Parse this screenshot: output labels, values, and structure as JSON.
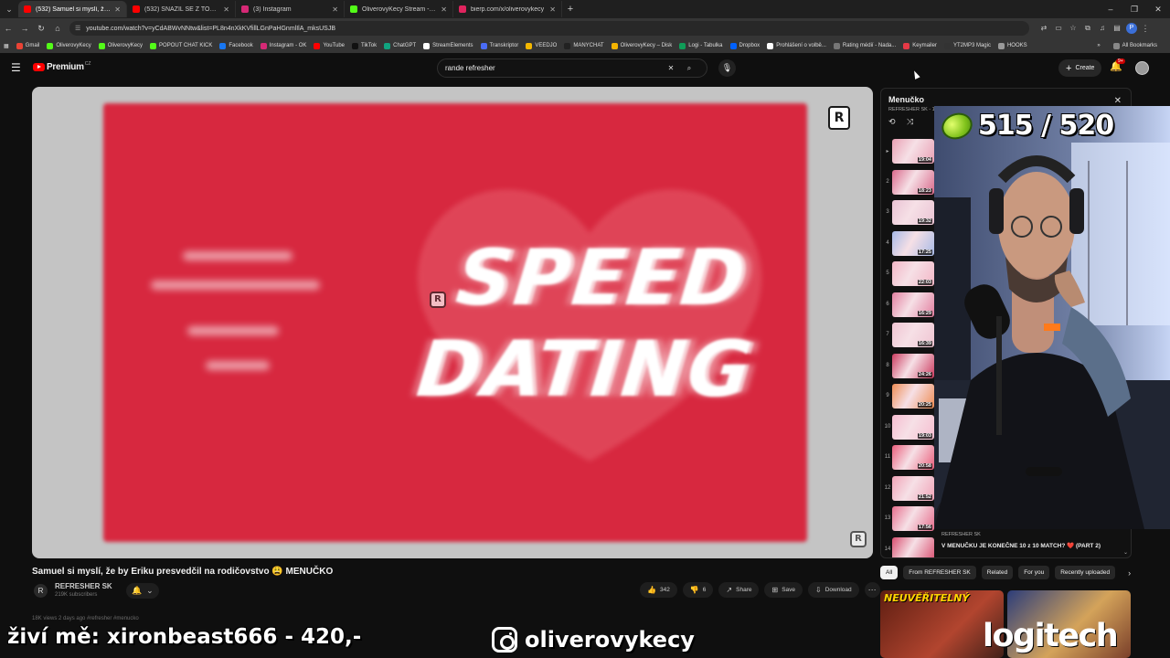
{
  "browser": {
    "tabs": [
      {
        "label": "(532) Samuel si myslí, že by",
        "favicon": "#ff0000",
        "active": true
      },
      {
        "label": "(532) SNAŽIL SE Z TOHO VYBR",
        "favicon": "#ff0000",
        "active": false
      },
      {
        "label": "(3) Instagram",
        "favicon": "#d62976",
        "active": false
      },
      {
        "label": "OliverovyKecy Stream - Watch",
        "favicon": "#53fc18",
        "active": false
      },
      {
        "label": "bierp.com/x/oliverovykecy",
        "favicon": "#e0245e",
        "active": false
      }
    ],
    "url": "youtube.com/watch?v=yCdABWvNNtw&list=PL8n4nXkKVfillLGnPaHGnmlIlA_mksUSJB",
    "bookmarks": [
      {
        "label": "Gmail",
        "color": "#ea4335"
      },
      {
        "label": "OliverovyKecy",
        "color": "#53fc18"
      },
      {
        "label": "OliverovyKecy",
        "color": "#53fc18"
      },
      {
        "label": "POPOUT CHAT KICK",
        "color": "#53fc18"
      },
      {
        "label": "Facebook",
        "color": "#1877f2"
      },
      {
        "label": "Instagram - OK",
        "color": "#d62976"
      },
      {
        "label": "YouTube",
        "color": "#ff0000"
      },
      {
        "label": "TikTok",
        "color": "#111111"
      },
      {
        "label": "ChatGPT",
        "color": "#10a37f"
      },
      {
        "label": "StreamElements",
        "color": "#ffffff"
      },
      {
        "label": "Transkriptor",
        "color": "#4a6cf7"
      },
      {
        "label": "VEEDJO",
        "color": "#f5b800"
      },
      {
        "label": "MANYCHAT",
        "color": "#222222"
      },
      {
        "label": "OliverovyKecy – Disk",
        "color": "#f4b400"
      },
      {
        "label": "Logi - Tabulka",
        "color": "#0f9d58"
      },
      {
        "label": "Dropbox",
        "color": "#0061ff"
      },
      {
        "label": "Prohlášení o volbě...",
        "color": "#ffffff"
      },
      {
        "label": "Rating médií - Nada...",
        "color": "#777777"
      },
      {
        "label": "Keymailer",
        "color": "#e63946"
      },
      {
        "label": "YT2MP3 Magic",
        "color": "#333333"
      },
      {
        "label": "HOOKS",
        "color": "#999999"
      }
    ],
    "all_bookmarks": "All Bookmarks"
  },
  "youtube": {
    "logo": "Premium",
    "logo_country": "CZ",
    "search_query": "rande refresher",
    "create_label": "Create",
    "notif_badge": "9+"
  },
  "video": {
    "title": "Samuel si myslí, že by Eriku presvedčil na rodičovstvo 😩 MENUČKO",
    "overlay_line1": "SPEED",
    "overlay_line2": "DATING",
    "channel_name": "REFRESHER SK",
    "channel_subs": "219K subscribers",
    "likes": "342",
    "dislikes": "6",
    "share": "Share",
    "save": "Save",
    "download": "Download",
    "description": "18K views  2 days ago  #refresher #menucko"
  },
  "playlist": {
    "title": "Menučko",
    "subtitle": "REFRESHER SK - 1",
    "items": [
      {
        "num": "▸",
        "duration": "19:04",
        "color": "#e9a0b4"
      },
      {
        "num": "2",
        "duration": "18:23",
        "color": "#d96a8c"
      },
      {
        "num": "3",
        "duration": "19:32",
        "color": "#eac3d4"
      },
      {
        "num": "4",
        "duration": "17:25",
        "color": "#a7b9e6"
      },
      {
        "num": "5",
        "duration": "22:03",
        "color": "#f2b6c6"
      },
      {
        "num": "6",
        "duration": "16:29",
        "color": "#e27fa0"
      },
      {
        "num": "7",
        "duration": "16:39",
        "color": "#f0c4d2"
      },
      {
        "num": "8",
        "duration": "24:26",
        "color": "#cc3d61"
      },
      {
        "num": "9",
        "duration": "20:25",
        "color": "#ee8d55"
      },
      {
        "num": "10",
        "duration": "19:03",
        "color": "#f6bdd0"
      },
      {
        "num": "11",
        "duration": "20:58",
        "color": "#ea5f7c"
      },
      {
        "num": "12",
        "duration": "21:52",
        "color": "#f0a4b8"
      },
      {
        "num": "13",
        "duration": "17:56",
        "color": "#e66e8d"
      },
      {
        "num": "14",
        "duration": "",
        "color": "#d94f70"
      }
    ],
    "current_channel": "REFRESHER SK",
    "current_title": "V MENUČKU JE KONEČNE 10 z 10 MATCH? ❤️ (PART 2)"
  },
  "chips": [
    "All",
    "From REFRESHER SK",
    "Related",
    "For you",
    "Recently uploaded"
  ],
  "recommendations": [
    {
      "label": "NEUVĚŘITELNÝ",
      "color": "#7a2a1c"
    },
    {
      "label": "",
      "color": "#3a4b86"
    }
  ],
  "stream_overlay": {
    "counter": "515 / 520",
    "donation": "živí mě: xironbeast666 - 420,-",
    "instagram": "oliverovykecy",
    "sponsor": "logitech"
  }
}
